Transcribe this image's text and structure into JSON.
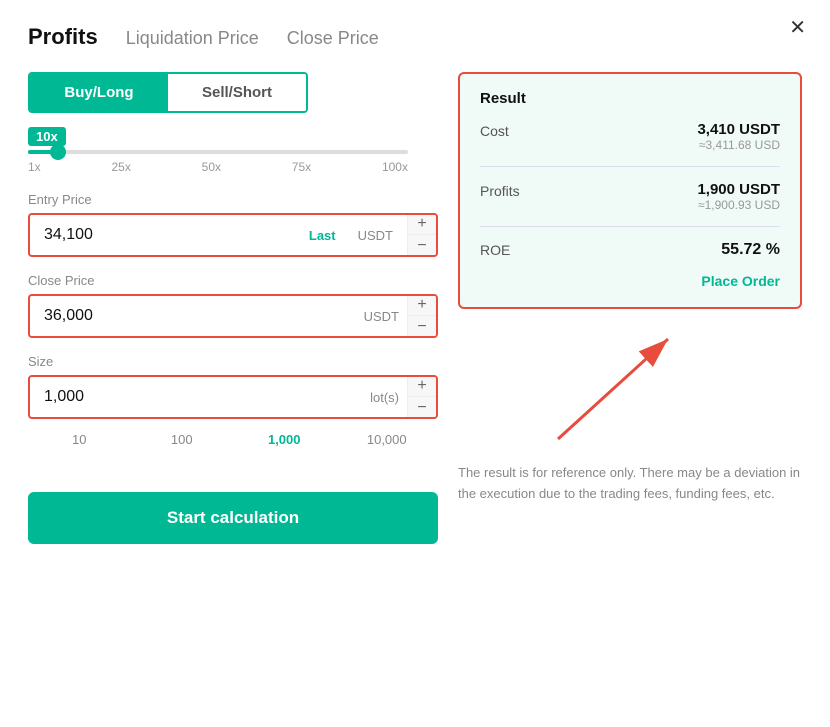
{
  "modal": {
    "close_label": "✕"
  },
  "tabs": [
    {
      "label": "Profits",
      "active": true
    },
    {
      "label": "Liquidation Price",
      "active": false
    },
    {
      "label": "Close Price",
      "active": false
    }
  ],
  "buy_sell": {
    "buy_label": "Buy/Long",
    "sell_label": "Sell/Short"
  },
  "leverage": {
    "badge": "10x",
    "marks": [
      "1x",
      "25x",
      "50x",
      "75x",
      "100x"
    ]
  },
  "entry_price": {
    "label": "Entry Price",
    "value": "34,100",
    "unit_last": "Last",
    "unit": "USDT"
  },
  "close_price": {
    "label": "Close Price",
    "value": "36,000",
    "unit": "USDT"
  },
  "size": {
    "label": "Size",
    "value": "1,000",
    "unit": "lot(s)",
    "quick_values": [
      "10",
      "100",
      "1,000",
      "10,000"
    ]
  },
  "calc_btn": "Start calculation",
  "result": {
    "title": "Result",
    "cost_label": "Cost",
    "cost_main": "3,410 USDT",
    "cost_sub": "≈3,411.68 USD",
    "profits_label": "Profits",
    "profits_main": "1,900 USDT",
    "profits_sub": "≈1,900.93 USD",
    "roe_label": "ROE",
    "roe_value": "55.72 %",
    "place_order": "Place Order"
  },
  "disclaimer": "The result is for reference only. There may be a deviation in the execution due to the trading fees, funding fees, etc."
}
